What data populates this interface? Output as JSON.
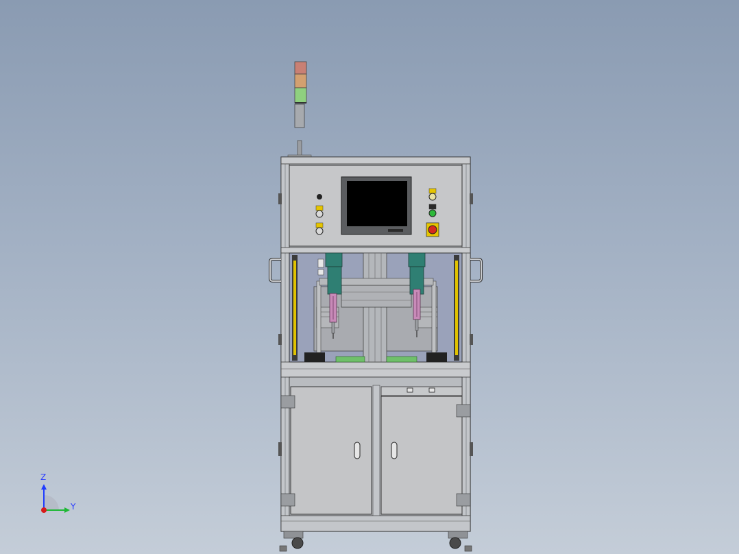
{
  "viewport": {
    "background_top": "#8a9bb2",
    "background_bottom": "#c4cdd8"
  },
  "machine": {
    "parts": [
      "tower-light",
      "control-panel",
      "hmi-screen",
      "work-chamber",
      "screwdriver-left",
      "screwdriver-right",
      "safety-light-curtain-left",
      "safety-light-curtain-right",
      "cabinet-door-left",
      "cabinet-door-right",
      "drawer",
      "caster-wheels"
    ],
    "tower_light_colors": [
      "#c98074",
      "#d3a070",
      "#8fd07f"
    ],
    "frame_color": "#b9bcc0",
    "panel_color": "#c6c7c9",
    "emergency_stop_color": "#d62a1e",
    "slide_color": "#2f7f73",
    "screwdriver_color": "#c88ab8"
  },
  "triad": {
    "z_label": "Z",
    "y_label": "Y",
    "z_color": "#1f3cff",
    "y_color": "#1db835",
    "origin_color": "#d81b1b"
  }
}
